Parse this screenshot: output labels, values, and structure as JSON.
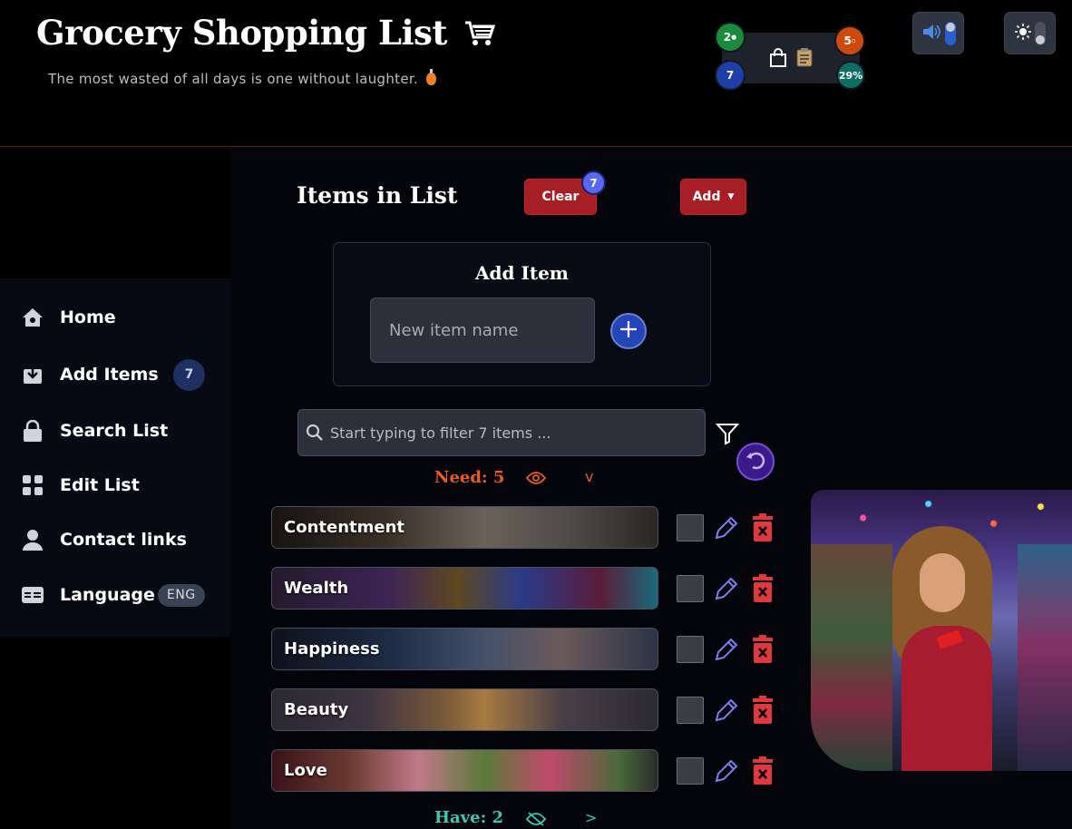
{
  "header": {
    "title": "Grocery Shopping List",
    "subtitle": "The most wasted of all days is one without laughter.",
    "stats": {
      "need_count": "2",
      "items_total": "7",
      "have_count": "5",
      "progress": "29%"
    }
  },
  "sidebar": {
    "items": [
      {
        "label": "Home",
        "icon": "home-icon"
      },
      {
        "label": "Add Items",
        "icon": "download-icon",
        "badge": "7"
      },
      {
        "label": "Search List",
        "icon": "lock-icon"
      },
      {
        "label": "Edit List",
        "icon": "grid-icon"
      },
      {
        "label": "Contact links",
        "icon": "person-icon"
      },
      {
        "label": "Language",
        "icon": "id-card-icon",
        "pill": "ENG"
      }
    ]
  },
  "main": {
    "title": "Items in List",
    "clear_label": "Clear",
    "clear_count": "7",
    "add_label": "Add",
    "add_card": {
      "title": "Add Item",
      "input_placeholder": "New item name"
    },
    "search": {
      "placeholder": "Start typing to filter 7 items ..."
    },
    "need_label": "Need: 5",
    "have_label": "Have: 2",
    "items": [
      {
        "label": "Contentment",
        "checked": false
      },
      {
        "label": "Wealth",
        "checked": false
      },
      {
        "label": "Happiness",
        "checked": false
      },
      {
        "label": "Beauty",
        "checked": false
      },
      {
        "label": "Love",
        "checked": false
      }
    ]
  },
  "colors": {
    "accent_red": "#a71e24",
    "need_orange": "#ee5a1a",
    "have_teal": "#3fc7b0",
    "edit_blue": "#7b7ff0",
    "delete_red": "#e0383e"
  }
}
